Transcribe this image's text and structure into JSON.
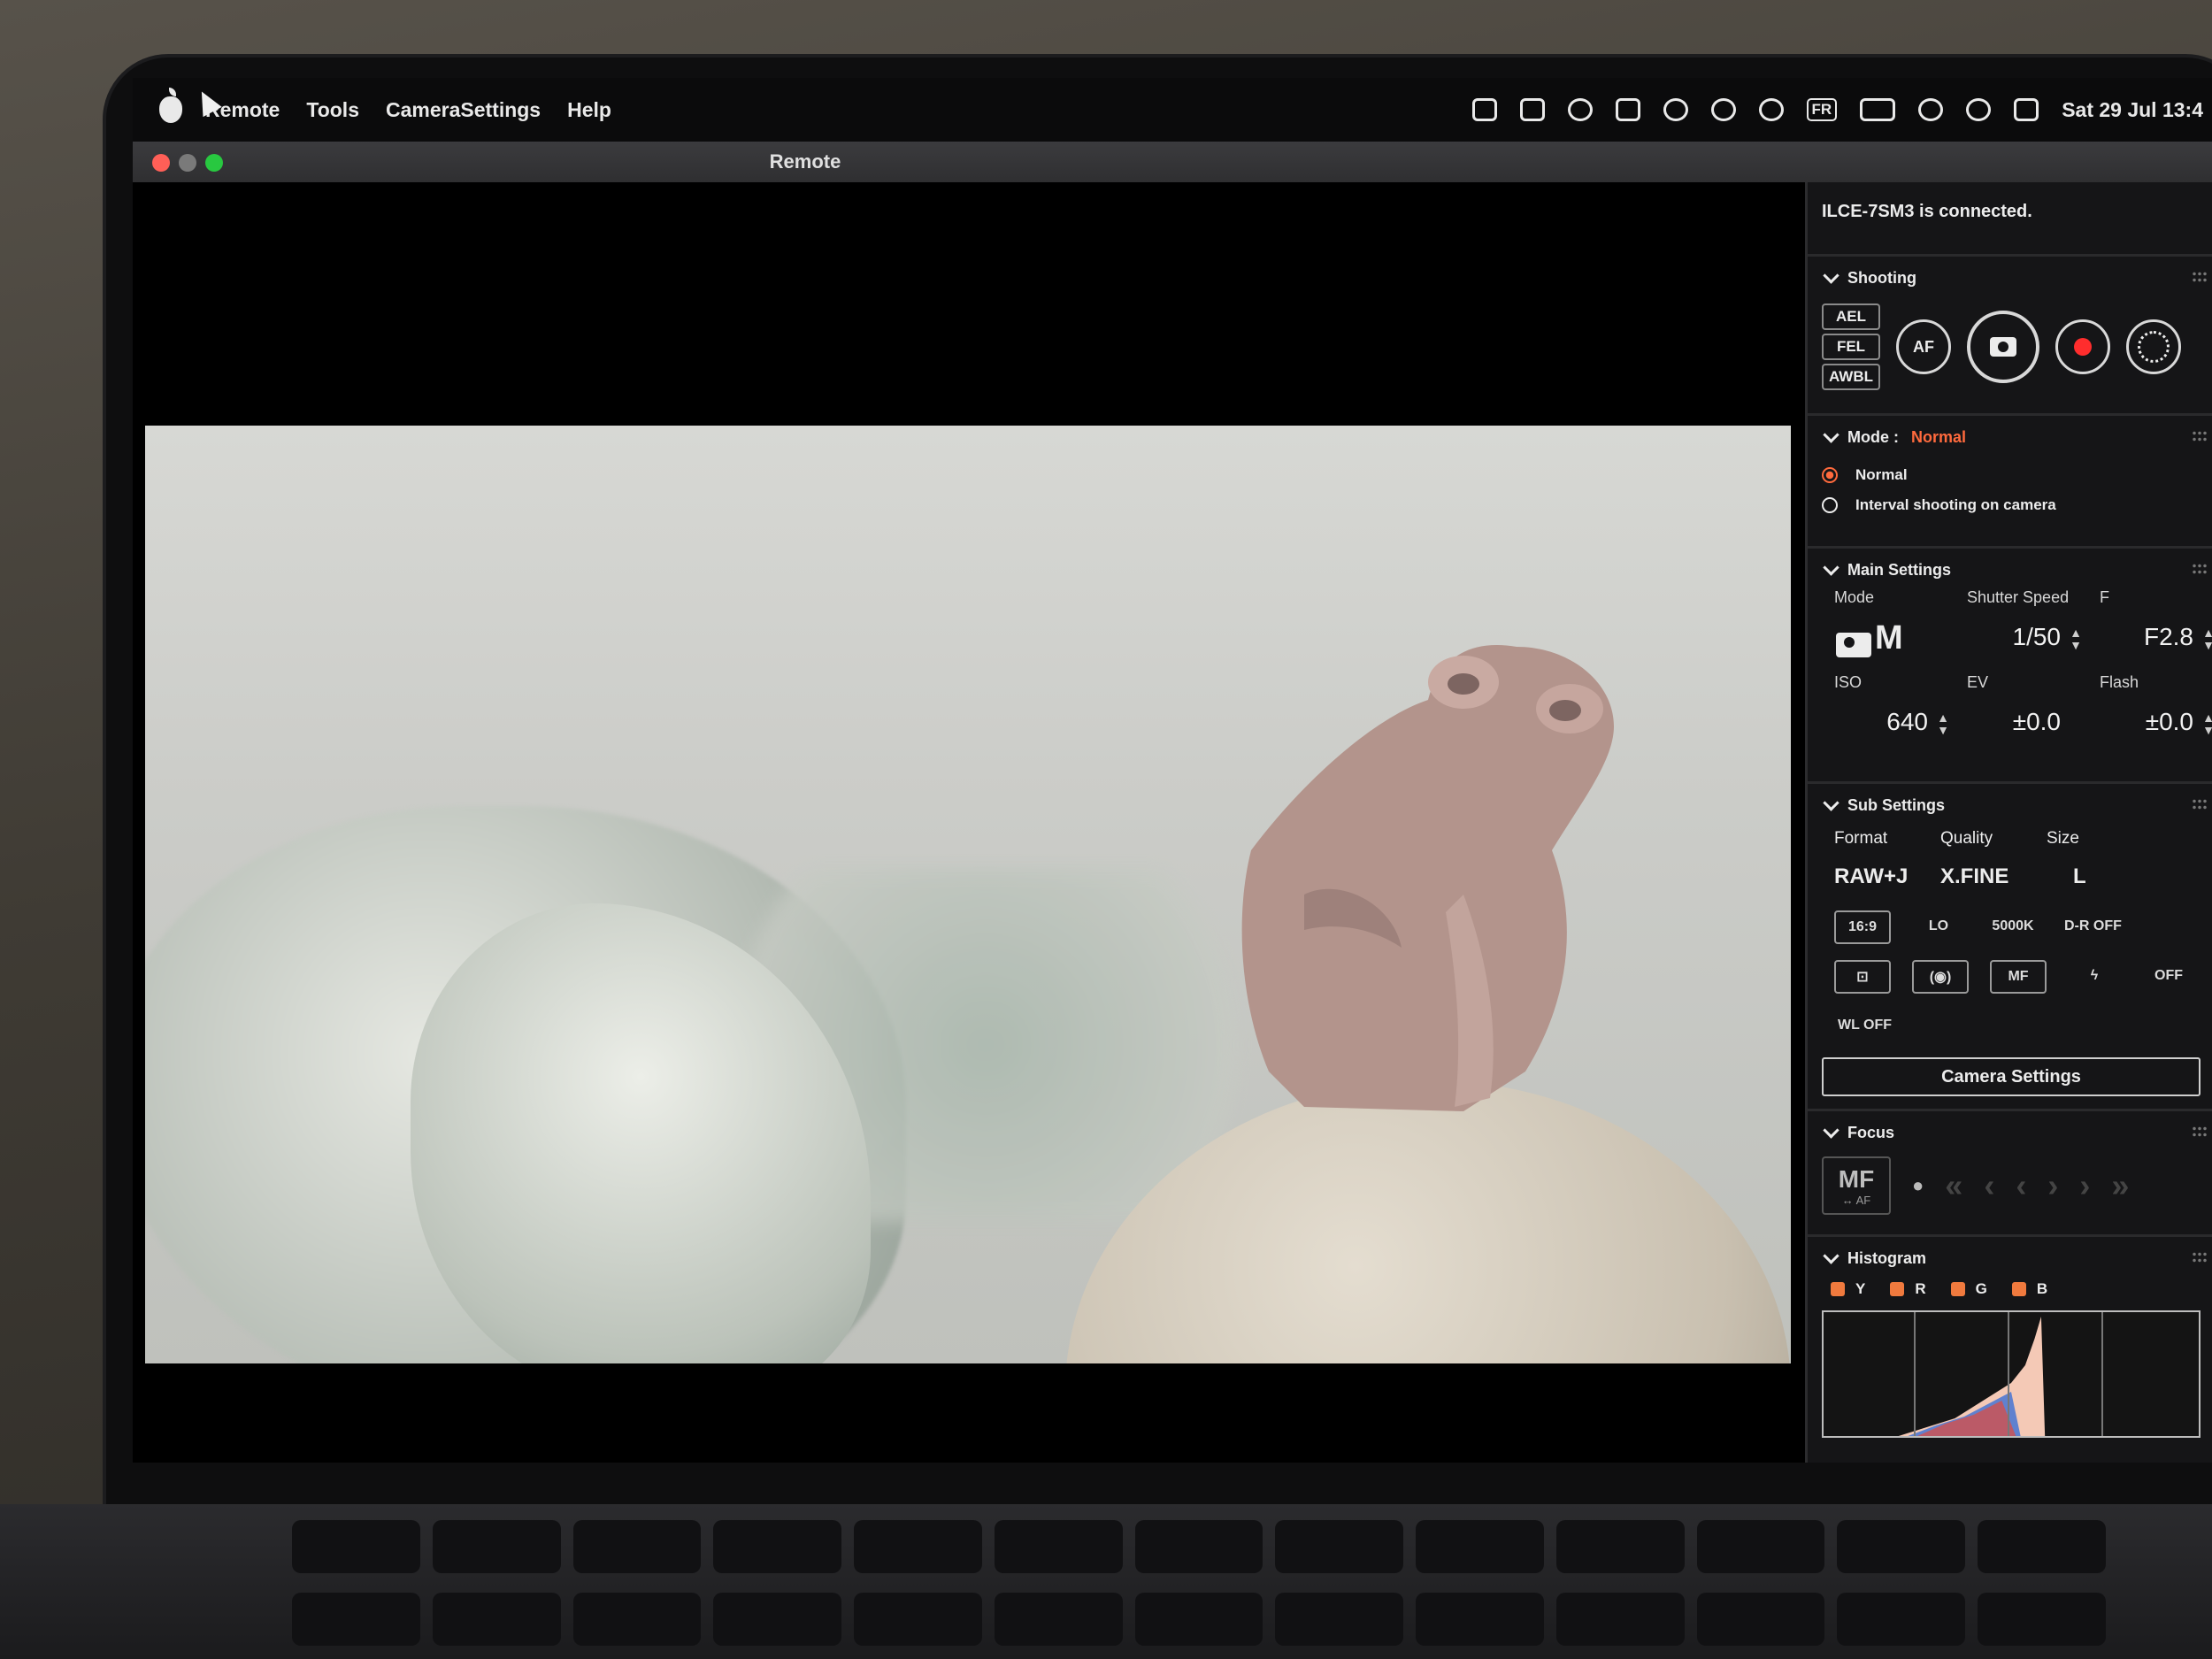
{
  "menubar": {
    "app_name": "Remote",
    "items": [
      "Tools",
      "CameraSettings",
      "Help"
    ],
    "input_source": "FR",
    "clock": "Sat 29 Jul 13:4"
  },
  "window": {
    "title": "Remote"
  },
  "panel": {
    "status": "ILCE-7SM3 is connected.",
    "shooting": {
      "title": "Shooting",
      "locks": [
        "AEL",
        "FEL",
        "AWBL"
      ],
      "af_label": "AF"
    },
    "mode": {
      "title": "Mode :",
      "value": "Normal",
      "options": [
        "Normal",
        "Interval shooting on camera"
      ]
    },
    "main_settings": {
      "title": "Main Settings",
      "labels": {
        "mode": "Mode",
        "shutter": "Shutter Speed",
        "f": "F",
        "iso": "ISO",
        "ev": "EV",
        "flash": "Flash"
      },
      "values": {
        "mode_letter": "M",
        "shutter": "1/50",
        "f": "F2.8",
        "iso": "640",
        "ev": "±0.0",
        "flash": "±0.0"
      }
    },
    "sub_settings": {
      "title": "Sub Settings",
      "labels": {
        "format": "Format",
        "quality": "Quality",
        "size": "Size"
      },
      "values": {
        "format": "RAW+J",
        "quality": "X.FINE",
        "size": "L"
      },
      "chips": [
        "16:9",
        "LO",
        "5000K",
        "D-R OFF",
        "MF",
        "OFF",
        "WL OFF"
      ],
      "button": "Camera Settings"
    },
    "focus": {
      "title": "Focus",
      "mode": "MF",
      "sub": "↔ AF"
    },
    "histogram": {
      "title": "Histogram",
      "channels": [
        "Y",
        "R",
        "G",
        "B"
      ]
    }
  },
  "colors": {
    "accent": "#ff6a3d",
    "record": "#ff2d2d",
    "checkbox": "#f07a3e"
  }
}
